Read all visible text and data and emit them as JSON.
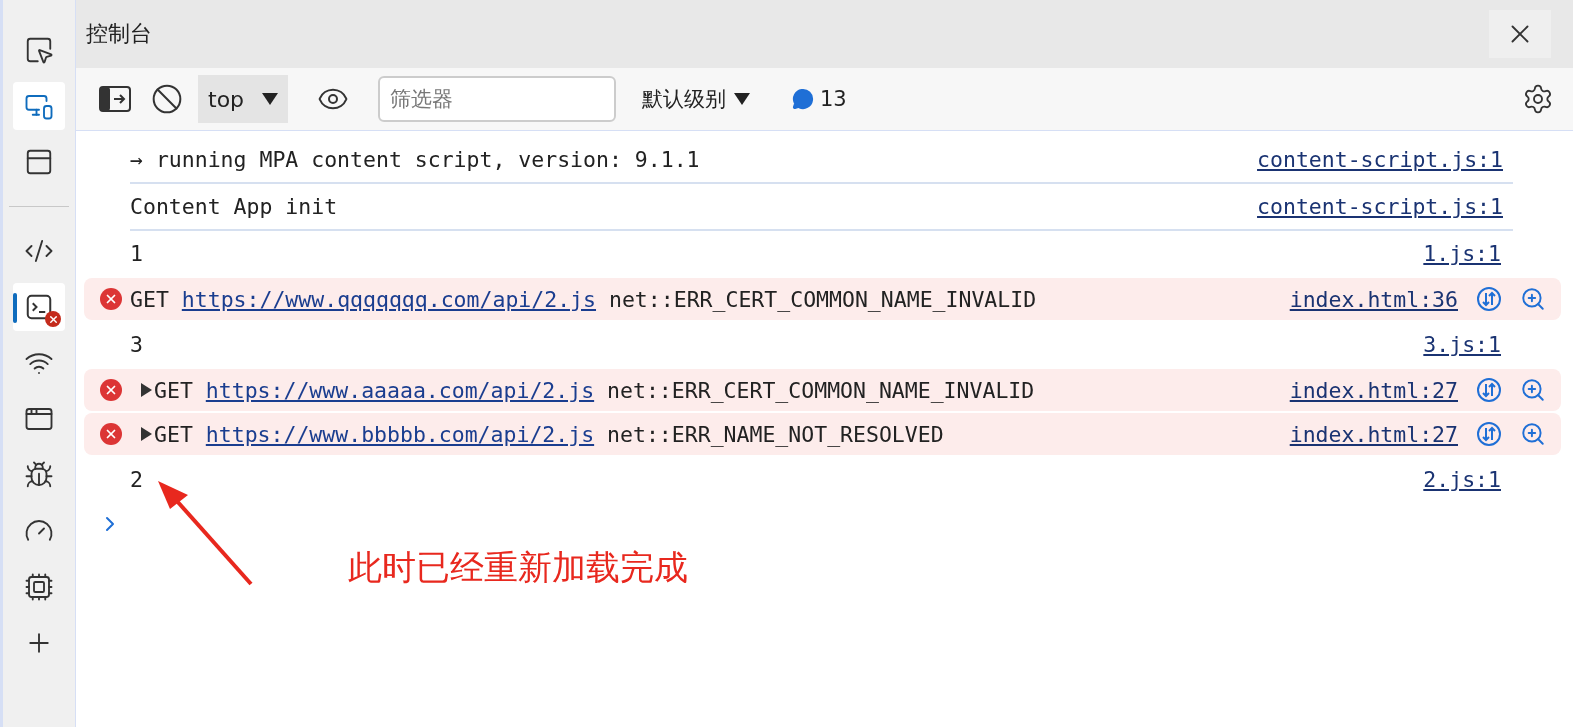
{
  "sidebar": {
    "top_tools": [
      {
        "kind": "inspect",
        "on": false
      },
      {
        "kind": "device",
        "on": true
      },
      {
        "kind": "dock",
        "on": false
      }
    ],
    "tools": [
      {
        "kind": "elements",
        "selected": false,
        "error_badge": false
      },
      {
        "kind": "console",
        "selected": true,
        "error_badge": true
      },
      {
        "kind": "network",
        "selected": false,
        "error_badge": false
      },
      {
        "kind": "application",
        "selected": false,
        "error_badge": false
      },
      {
        "kind": "sources",
        "selected": false,
        "error_badge": false
      },
      {
        "kind": "performance",
        "selected": false,
        "error_badge": false
      },
      {
        "kind": "memory",
        "selected": false,
        "error_badge": false
      },
      {
        "kind": "more",
        "selected": false,
        "error_badge": false
      }
    ]
  },
  "panel": {
    "title": "控制台"
  },
  "toolbar": {
    "context": "top",
    "filter": {
      "placeholder": "筛选器"
    },
    "level": "默认级别",
    "message_count": "13"
  },
  "console": {
    "rows": [
      {
        "kind": "script",
        "text": "→ running MPA content script, version: 9.1.1",
        "source": "content-script.js:1"
      },
      {
        "kind": "script",
        "text": "Content App init",
        "source": "content-script.js:1"
      },
      {
        "kind": "log",
        "text": "1",
        "source": "1.js:1"
      },
      {
        "kind": "error",
        "expandable": false,
        "method": "GET",
        "url": "https://www.qqqqqqq.com/api/2.js",
        "text": "net::ERR_CERT_COMMON_NAME_INVALID",
        "source": "index.html:36"
      },
      {
        "kind": "log",
        "text": "3",
        "source": "3.js:1"
      },
      {
        "kind": "error",
        "expandable": true,
        "method": "GET",
        "url": "https://www.aaaaa.com/api/2.js",
        "text": "net::ERR_CERT_COMMON_NAME_INVALID",
        "source": "index.html:27"
      },
      {
        "kind": "error",
        "expandable": true,
        "method": "GET",
        "url": "https://www.bbbbb.com/api/2.js",
        "text": "net::ERR_NAME_NOT_RESOLVED",
        "source": "index.html:27"
      },
      {
        "kind": "log",
        "text": "2",
        "source": "2.js:1"
      }
    ]
  },
  "annotation": {
    "text": "此时已经重新加载完成"
  }
}
